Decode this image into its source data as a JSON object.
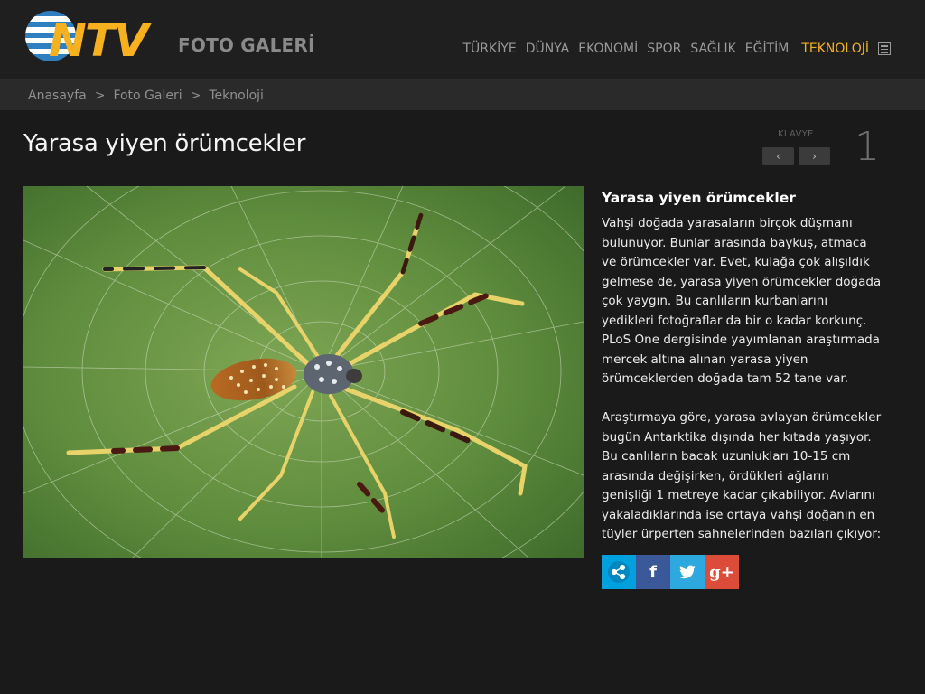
{
  "brand": {
    "logo_text": "NTV",
    "section": "FOTO GALERİ"
  },
  "nav": {
    "items": [
      "TÜRKİYE",
      "DÜNYA",
      "EKONOMİ",
      "SPOR",
      "SAĞLIK",
      "EĞİTİM"
    ],
    "active": "TEKNOLOJİ"
  },
  "breadcrumb": {
    "items": [
      "Anasayfa",
      "Foto Galeri",
      "Teknoloji"
    ],
    "separator": ">"
  },
  "page": {
    "title": "Yarasa yiyen örümcekler"
  },
  "keyboard": {
    "label": "KLAVYE",
    "prev": "‹",
    "next": "›"
  },
  "photo": {
    "number": "1"
  },
  "caption": {
    "title": "Yarasa yiyen örümcekler",
    "paragraphs": [
      "Vahşi doğada yarasaların birçok düşmanı bulunuyor. Bunlar arasında baykuş, atmaca ve örümcekler var. Evet, kulağa çok alışıldık gelmese de, yarasa yiyen örümcekler doğada çok yaygın. Bu canlıların kurbanlarını yedikleri fotoğraflar da bir o kadar korkunç. PLoS One dergisinde yayımlanan araştırmada mercek altına alınan yarasa yiyen örümceklerden doğada tam 52 tane var.",
      "Araştırmaya göre, yarasa avlayan örümcekler bugün Antarktika dışında her kıtada yaşıyor. Bu canlıların bacak uzunlukları 10-15 cm arasında değişirken, ördükleri ağların genişliği 1 metreye kadar çıkabiliyor. Avlarını yakaladıklarında ise ortaya vahşi doğanın en tüyler ürperten sahnelerinden bazıları çıkıyor:"
    ]
  },
  "share": {
    "facebook": "f",
    "twitter": "t",
    "google": "g+"
  },
  "colors": {
    "accent": "#f7b11f",
    "share": "#00a0df",
    "facebook": "#3b5998",
    "twitter": "#2ea9df",
    "google": "#dd4b39"
  }
}
